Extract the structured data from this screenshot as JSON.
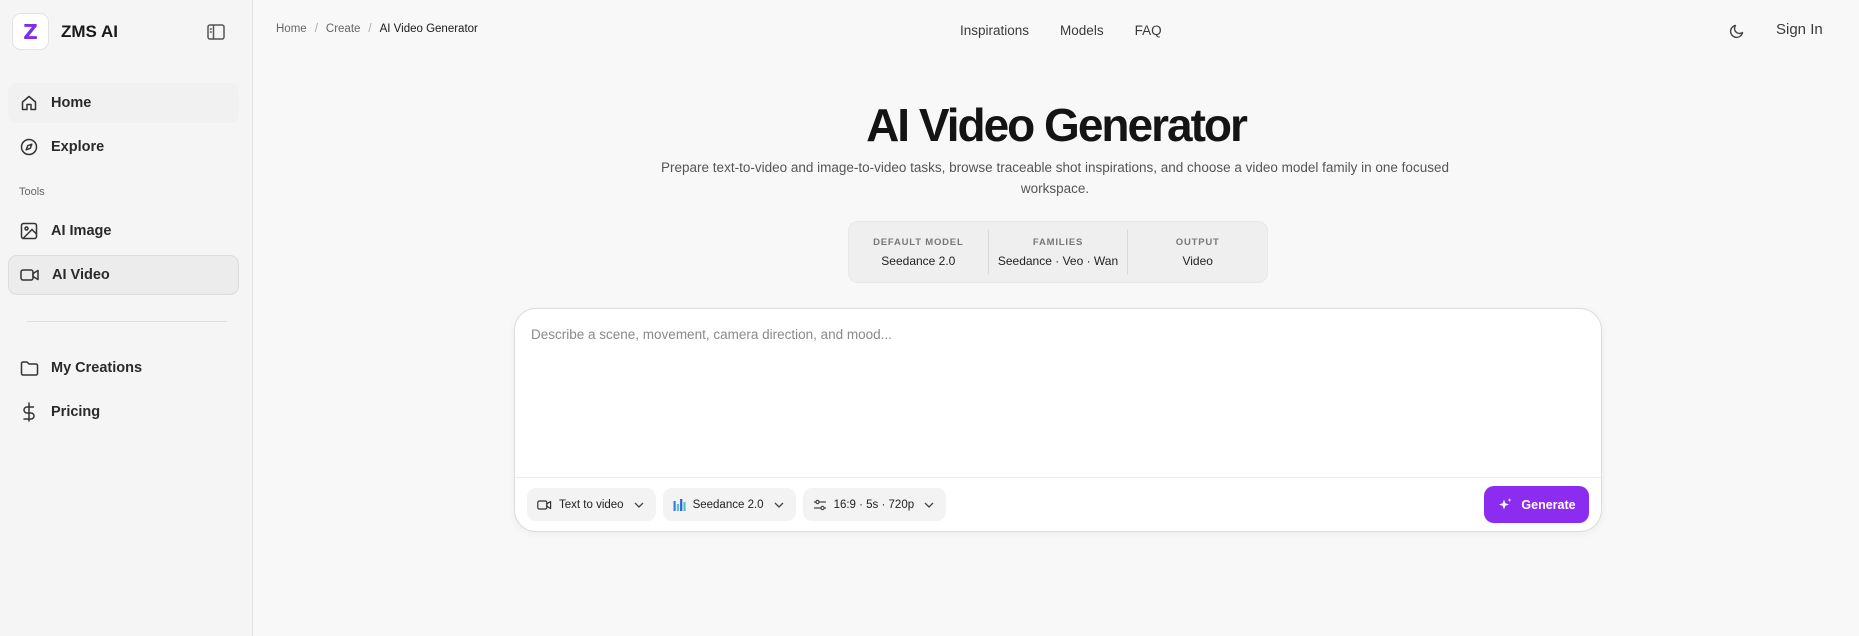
{
  "sidebar": {
    "brand": "ZMS AI",
    "logo_letter": "Z",
    "items": [
      {
        "label": "Home"
      },
      {
        "label": "Explore"
      },
      {
        "label": "AI Image"
      },
      {
        "label": "AI Video"
      },
      {
        "label": "My Creations"
      },
      {
        "label": "Pricing"
      }
    ],
    "section_tools": "Tools"
  },
  "breadcrumb": [
    "Home",
    "Create",
    "AI Video Generator"
  ],
  "topnav": [
    "Inspirations",
    "Models",
    "FAQ"
  ],
  "signin": "Sign In",
  "hero": {
    "title": "AI Video Generator",
    "subtitle": "Prepare text-to-video and image-to-video tasks, browse traceable shot inspirations, and choose a video model family in one focused workspace."
  },
  "stats": [
    {
      "key": "DEFAULT MODEL",
      "value": "Seedance 2.0"
    },
    {
      "key": "FAMILIES",
      "value": "Seedance · Veo · Wan"
    },
    {
      "key": "OUTPUT",
      "value": "Video"
    }
  ],
  "composer": {
    "placeholder": "Describe a scene, movement, camera direction, and mood...",
    "mode": "Text to video",
    "model": "Seedance 2.0",
    "settings": "16:9 · 5s · 720p",
    "generate": "Generate"
  },
  "colors": {
    "accent": "#8b2cf0",
    "logo": "#7b2ff2"
  }
}
